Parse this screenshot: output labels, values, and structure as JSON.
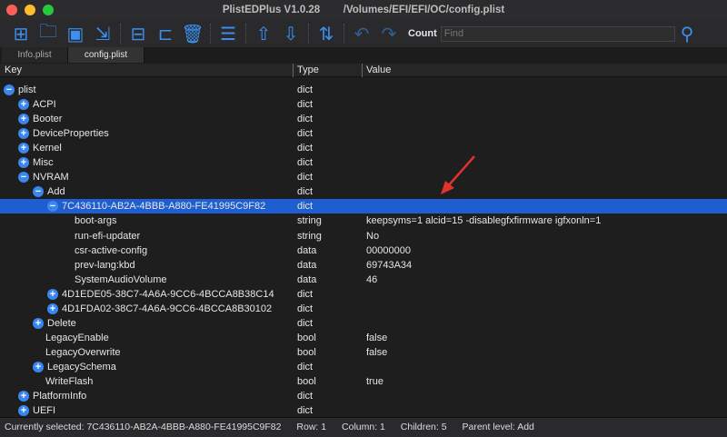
{
  "window": {
    "title": "PlistEDPlus  V1.0.28",
    "path": "/Volumes/EFI/EFI/OC/config.plist"
  },
  "toolbar": {
    "buttons": [
      "new-file",
      "open-folder",
      "save",
      "save-as",
      "add-sibling",
      "add-child",
      "delete",
      "sort-list",
      "move-up",
      "move-down",
      "sort",
      "undo",
      "redo"
    ],
    "count_label": "Count",
    "find_placeholder": "Find"
  },
  "tabs": [
    {
      "label": "Info.plist",
      "active": false
    },
    {
      "label": "config.plist",
      "active": true
    }
  ],
  "columns": {
    "key": "Key",
    "type": "Type",
    "value": "Value"
  },
  "rows": [
    {
      "key": "plist",
      "type": "dict",
      "value": "",
      "level": 0,
      "exp": "-"
    },
    {
      "key": "ACPI",
      "type": "dict",
      "value": "",
      "level": 1,
      "exp": "+"
    },
    {
      "key": "Booter",
      "type": "dict",
      "value": "",
      "level": 1,
      "exp": "+"
    },
    {
      "key": "DeviceProperties",
      "type": "dict",
      "value": "",
      "level": 1,
      "exp": "+"
    },
    {
      "key": "Kernel",
      "type": "dict",
      "value": "",
      "level": 1,
      "exp": "+"
    },
    {
      "key": "Misc",
      "type": "dict",
      "value": "",
      "level": 1,
      "exp": "+"
    },
    {
      "key": "NVRAM",
      "type": "dict",
      "value": "",
      "level": 1,
      "exp": "-"
    },
    {
      "key": "Add",
      "type": "dict",
      "value": "",
      "level": 2,
      "exp": "-"
    },
    {
      "key": "7C436110-AB2A-4BBB-A880-FE41995C9F82",
      "type": "dict",
      "value": "",
      "level": 3,
      "exp": "-",
      "selected": true
    },
    {
      "key": "boot-args",
      "type": "string",
      "value": "keepsyms=1 alcid=15 -disablegfxfirmware igfxonln=1",
      "level": 4
    },
    {
      "key": "run-efi-updater",
      "type": "string",
      "value": "No",
      "level": 4
    },
    {
      "key": "csr-active-config",
      "type": "data",
      "value": "00000000",
      "level": 4
    },
    {
      "key": "prev-lang:kbd",
      "type": "data",
      "value": "69743A34",
      "level": 4
    },
    {
      "key": "SystemAudioVolume",
      "type": "data",
      "value": "46",
      "level": 4
    },
    {
      "key": "4D1EDE05-38C7-4A6A-9CC6-4BCCA8B38C14",
      "type": "dict",
      "value": "",
      "level": 3,
      "exp": "+"
    },
    {
      "key": "4D1FDA02-38C7-4A6A-9CC6-4BCCA8B30102",
      "type": "dict",
      "value": "",
      "level": 3,
      "exp": "+"
    },
    {
      "key": "Delete",
      "type": "dict",
      "value": "",
      "level": 2,
      "exp": "+"
    },
    {
      "key": "LegacyEnable",
      "type": "bool",
      "value": "false",
      "level": 2
    },
    {
      "key": "LegacyOverwrite",
      "type": "bool",
      "value": "false",
      "level": 2
    },
    {
      "key": "LegacySchema",
      "type": "dict",
      "value": "",
      "level": 2,
      "exp": "+"
    },
    {
      "key": "WriteFlash",
      "type": "bool",
      "value": "true",
      "level": 2
    },
    {
      "key": "PlatformInfo",
      "type": "dict",
      "value": "",
      "level": 1,
      "exp": "+"
    },
    {
      "key": "UEFI",
      "type": "dict",
      "value": "",
      "level": 1,
      "exp": "+"
    }
  ],
  "status": {
    "selected": "Currently selected: 7C436110-AB2A-4BBB-A880-FE41995C9F82",
    "row": "Row: 1",
    "column": "Column: 1",
    "children": "Children: 5",
    "parent": "Parent level:  Add"
  },
  "colors": {
    "accent": "#3a86ee",
    "selection": "#1f5ed1",
    "annotation_arrow": "#e0332b"
  }
}
